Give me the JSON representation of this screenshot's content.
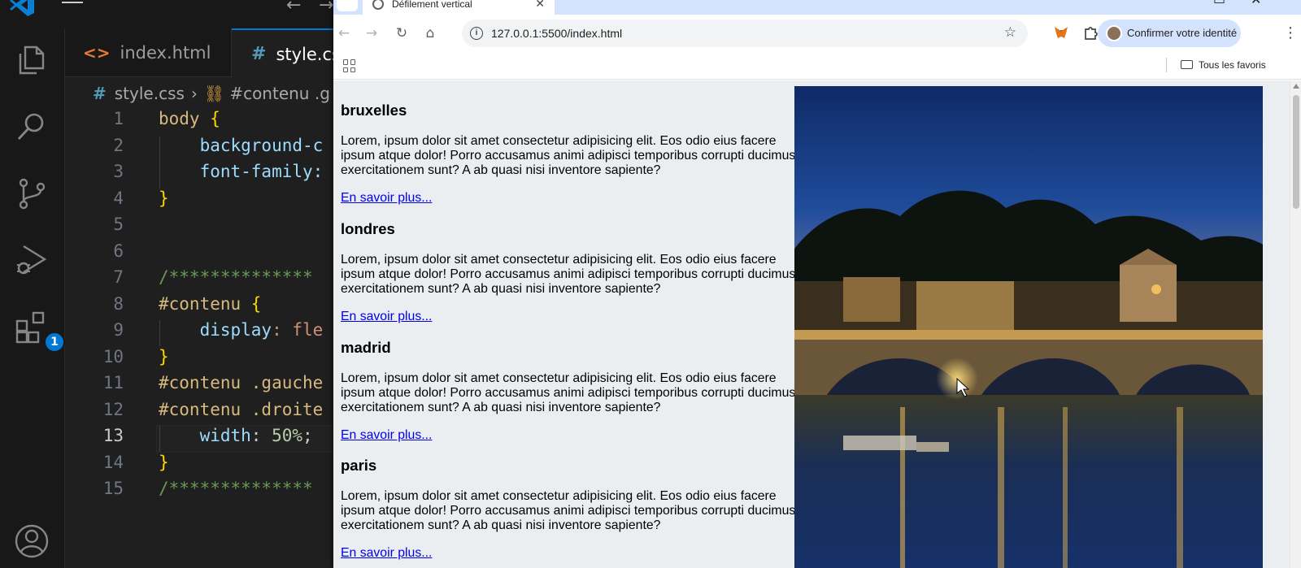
{
  "vscode": {
    "tabs": [
      {
        "label": "index.html",
        "icon": "html-icon"
      },
      {
        "label": "style.css",
        "icon": "css-icon"
      }
    ],
    "breadcrumb": {
      "file": "style.css",
      "symbol": "#contenu .g"
    },
    "extensions_badge": "1",
    "lines": [
      {
        "n": "1",
        "tokens": [
          {
            "t": "body ",
            "c": "sel"
          },
          {
            "t": "{",
            "c": "brace"
          }
        ]
      },
      {
        "n": "2",
        "tokens": [
          {
            "t": "    background-c",
            "c": "prop"
          }
        ]
      },
      {
        "n": "3",
        "tokens": [
          {
            "t": "    font-family:",
            "c": "prop"
          }
        ]
      },
      {
        "n": "4",
        "tokens": [
          {
            "t": "}",
            "c": "brace"
          }
        ]
      },
      {
        "n": "5",
        "tokens": []
      },
      {
        "n": "6",
        "tokens": []
      },
      {
        "n": "7",
        "tokens": [
          {
            "t": "/**************",
            "c": "cmt"
          }
        ]
      },
      {
        "n": "8",
        "tokens": [
          {
            "t": "#contenu ",
            "c": "sel"
          },
          {
            "t": "{",
            "c": "brace"
          }
        ]
      },
      {
        "n": "9",
        "tokens": [
          {
            "t": "    display",
            "c": "prop"
          },
          {
            "t": ": fle",
            "c": "val"
          }
        ]
      },
      {
        "n": "10",
        "tokens": [
          {
            "t": "}",
            "c": "brace"
          }
        ]
      },
      {
        "n": "11",
        "tokens": [
          {
            "t": "#contenu .gauche",
            "c": "sel"
          }
        ]
      },
      {
        "n": "12",
        "tokens": [
          {
            "t": "#contenu .droite",
            "c": "sel"
          }
        ]
      },
      {
        "n": "13",
        "tokens": [
          {
            "t": "    width",
            "c": "prop"
          },
          {
            "t": ": ",
            "c": ""
          },
          {
            "t": "50%",
            "c": "num"
          },
          {
            "t": ";",
            "c": ""
          }
        ]
      },
      {
        "n": "14",
        "tokens": [
          {
            "t": "}",
            "c": "brace"
          }
        ]
      },
      {
        "n": "15",
        "tokens": [
          {
            "t": "/**************",
            "c": "cmt"
          }
        ]
      }
    ],
    "active_line": "13"
  },
  "browser": {
    "tab_title": "Défilement vertical",
    "url": "127.0.0.1:5500/index.html",
    "profile_label": "Confirmer votre identité",
    "bookmarks_all": "Tous les favoris",
    "cities": [
      {
        "name": "bruxelles",
        "text": "Lorem, ipsum dolor sit amet consectetur adipisicing elit. Eos odio eius facere ipsum atque dolor! Porro accusamus animi adipisci temporibus corrupti ducimus exercitationem sunt? A ab quasi nisi inventore sapiente?",
        "link": "En savoir plus..."
      },
      {
        "name": "londres",
        "text": "Lorem, ipsum dolor sit amet consectetur adipisicing elit. Eos odio eius facere ipsum atque dolor! Porro accusamus animi adipisci temporibus corrupti ducimus exercitationem sunt? A ab quasi nisi inventore sapiente?",
        "link": "En savoir plus..."
      },
      {
        "name": "madrid",
        "text": "Lorem, ipsum dolor sit amet consectetur adipisicing elit. Eos odio eius facere ipsum atque dolor! Porro accusamus animi adipisci temporibus corrupti ducimus exercitationem sunt? A ab quasi nisi inventore sapiente?",
        "link": "En savoir plus..."
      },
      {
        "name": "paris",
        "text": "Lorem, ipsum dolor sit amet consectetur adipisicing elit. Eos odio eius facere ipsum atque dolor! Porro accusamus animi adipisci temporibus corrupti ducimus exercitationem sunt? A ab quasi nisi inventore sapiente?",
        "link": "En savoir plus..."
      }
    ]
  },
  "colors": {
    "vscode_bg": "#1f1f1f",
    "vscode_accent": "#0078d4",
    "chrome_tabstrip": "#d3e3fd",
    "page_bg": "#eaeef1",
    "link": "#0000ee"
  }
}
